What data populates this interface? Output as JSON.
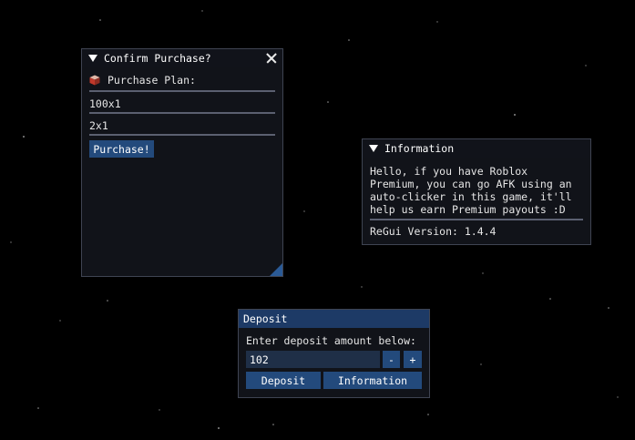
{
  "purchase_window": {
    "title": "Confirm Purchase?",
    "plan_label": "Purchase Plan:",
    "option_1": "100x1",
    "option_2": "2x1",
    "purchase_button": "Purchase!"
  },
  "info_window": {
    "title": "Information",
    "lines": [
      "Hello, if you have Roblox",
      "Premium, you can go AFK using an",
      "auto-clicker in this game, it'll",
      "help us earn Premium payouts :D"
    ],
    "version": "ReGui Version: 1.4.4"
  },
  "deposit_window": {
    "title": "Deposit",
    "prompt": "Enter deposit amount below:",
    "amount_value": "102",
    "minus_label": "-",
    "plus_label": "+",
    "deposit_button": "Deposit",
    "information_button": "Information"
  },
  "colors": {
    "background": "#000000",
    "window_bg": "#12141a",
    "active_title": "#1d3a66",
    "button": "#234a7c"
  },
  "icons": {
    "collapse": "triangle-down-icon",
    "close": "close-icon",
    "plan": "box-icon"
  }
}
